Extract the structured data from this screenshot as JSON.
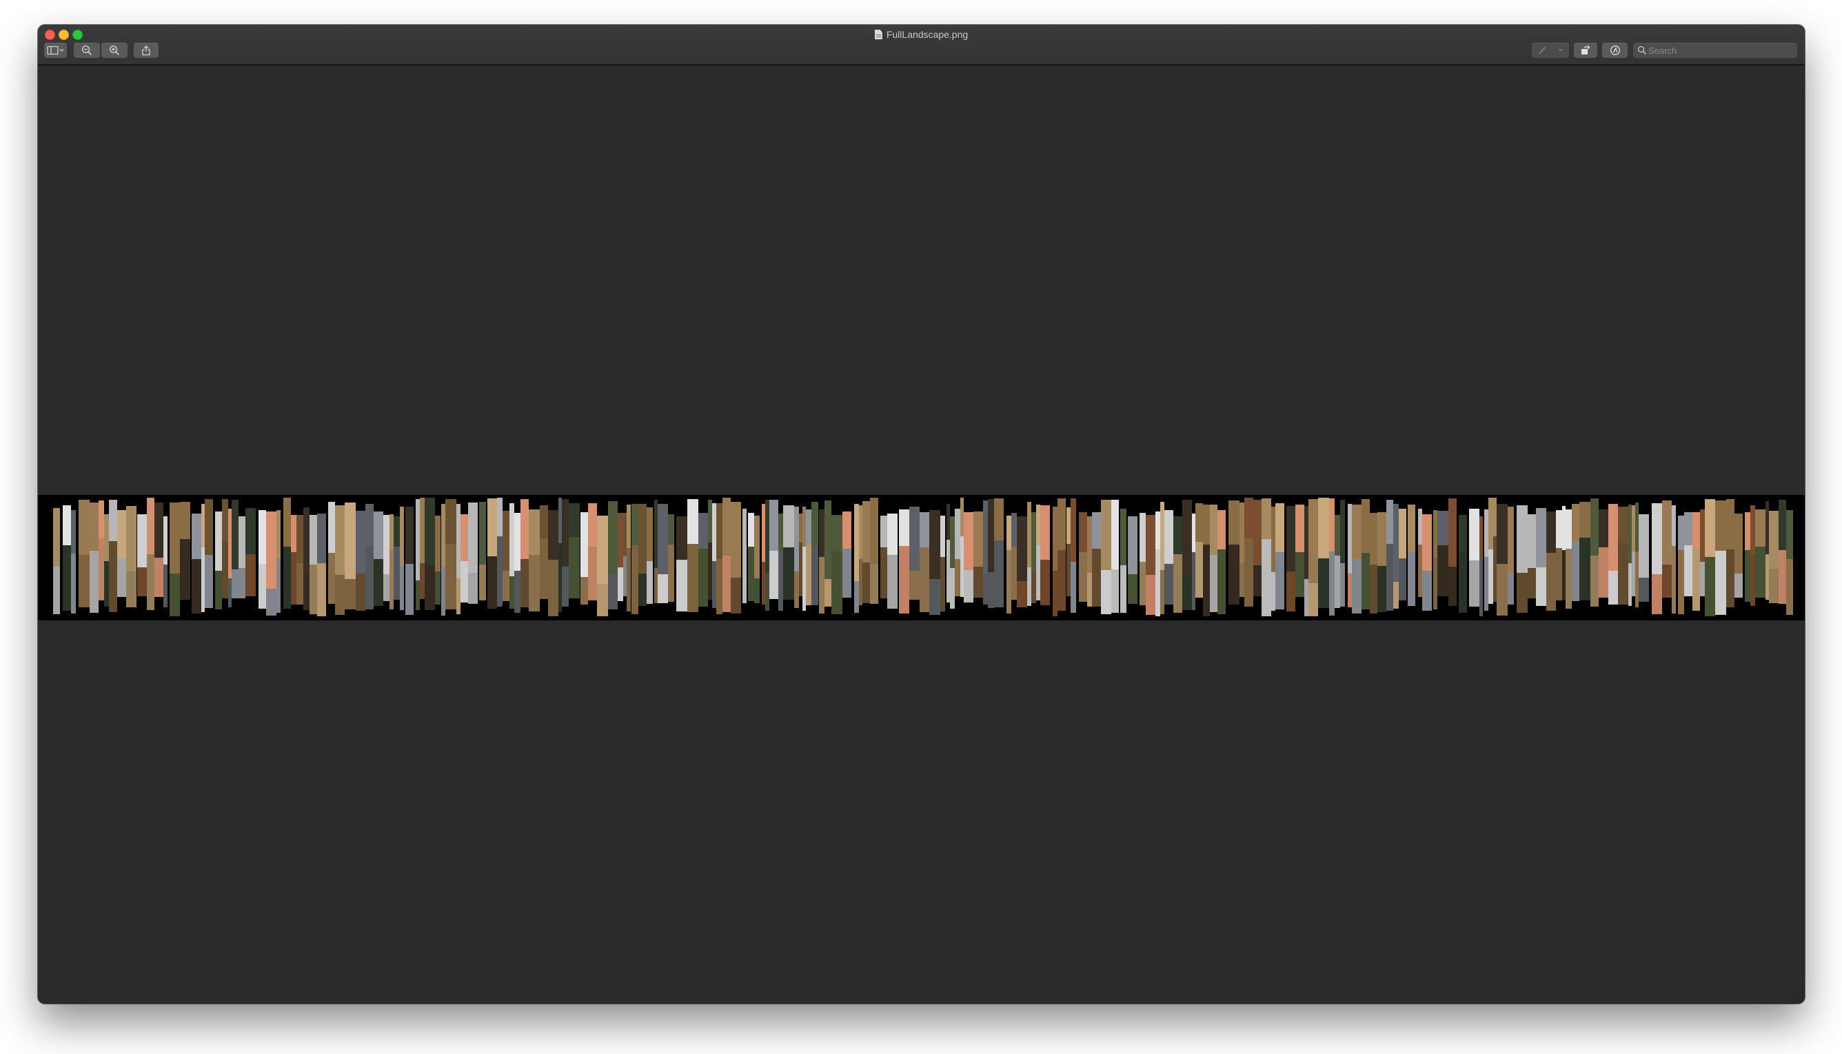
{
  "window": {
    "title": "FullLandscape.png",
    "traffic_lights": [
      "close",
      "minimize",
      "zoom"
    ]
  },
  "toolbar": {
    "left_buttons": [
      {
        "name": "sidebar-toggle-button",
        "icon": "sidebar-icon"
      },
      {
        "name": "zoom-out-button",
        "icon": "zoom-out-icon"
      },
      {
        "name": "zoom-in-button",
        "icon": "zoom-in-icon"
      },
      {
        "name": "share-button",
        "icon": "share-icon"
      }
    ],
    "right_buttons": [
      {
        "name": "markup-pen-button",
        "icon": "pen-icon"
      },
      {
        "name": "rotate-button",
        "icon": "rotate-icon"
      },
      {
        "name": "markup-toolbar-button",
        "icon": "markup-icon"
      }
    ],
    "search_placeholder": "Search"
  },
  "image": {
    "description_colors": [
      "#3a2f24",
      "#6b5233",
      "#8a6d45",
      "#a58a62",
      "#c9a77c",
      "#d68f6f",
      "#b7b7b7",
      "#8f949c",
      "#5d6066",
      "#2f3a2a",
      "#4e5a3a",
      "#e2e2e2",
      "#7a4e2f",
      "#cfcfcf",
      "#9a7a52"
    ]
  },
  "colors": {
    "window_bg": "#2a2a2a",
    "titlebar": "#383838",
    "close": "#fe5f57",
    "minimize": "#febc2e",
    "zoom": "#28c840"
  }
}
